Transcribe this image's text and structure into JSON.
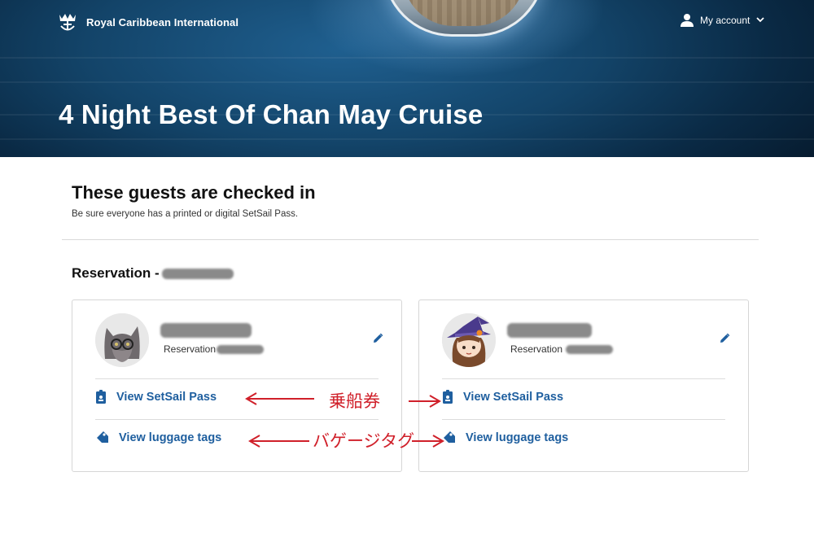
{
  "header": {
    "brand_name": "Royal Caribbean International",
    "account_label": "My account",
    "cruise_title": "4 Night Best Of Chan May Cruise"
  },
  "checkin": {
    "title": "These guests are checked in",
    "subtitle": "Be sure everyone has a printed or digital SetSail Pass.",
    "reservation_label": "Reservation -"
  },
  "guests": [
    {
      "reservation_label": "Reservation",
      "setsail_label": "View SetSail Pass",
      "luggage_label": "View luggage tags"
    },
    {
      "reservation_label": "Reservation",
      "setsail_label": "View SetSail Pass",
      "luggage_label": "View luggage tags"
    }
  ],
  "annotations": {
    "boarding_pass": "乗船券",
    "baggage_tag": "バゲージタグ"
  },
  "colors": {
    "link_blue": "#1f5f9f",
    "annotation_red": "#d0202a",
    "hero_dark": "#0a2a45"
  }
}
